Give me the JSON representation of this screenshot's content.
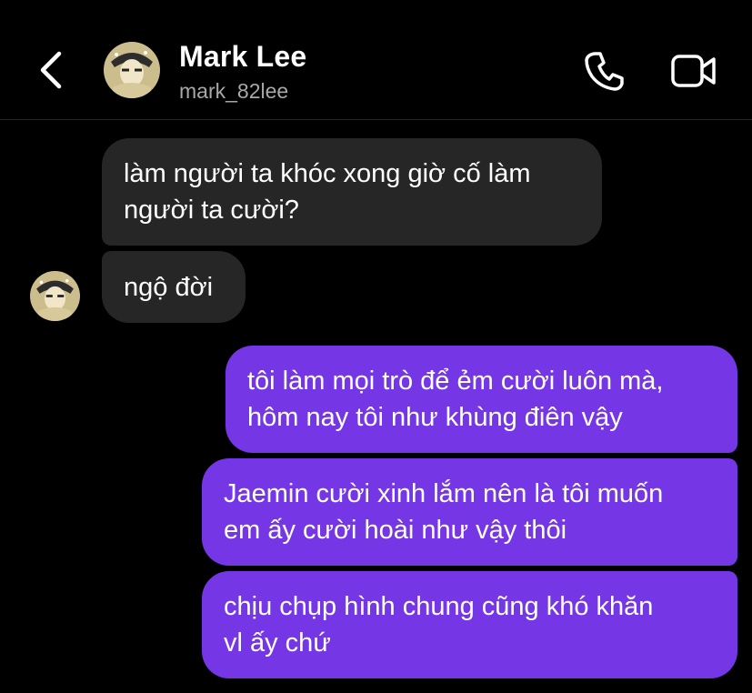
{
  "header": {
    "name": "Mark Lee",
    "username": "mark_82lee"
  },
  "icons": {
    "back": "chevron-left-icon",
    "call": "phone-icon",
    "video": "video-camera-icon"
  },
  "colors": {
    "background": "#000000",
    "incoming_bubble": "#262626",
    "outgoing_bubble": "#7537e6",
    "secondary_text": "#a8a8a8"
  },
  "messages": [
    {
      "direction": "incoming",
      "text": "làm người ta khóc xong giờ cố làm\nngười ta cười?"
    },
    {
      "direction": "incoming",
      "text": "ngộ đời"
    },
    {
      "direction": "outgoing",
      "text": "tôi làm mọi trò để ẻm cười luôn mà,\nhôm nay tôi như khùng điên vậy"
    },
    {
      "direction": "outgoing",
      "text": "Jaemin cười xinh lắm nên là tôi muốn\nem ấy cười hoài như vậy thôi"
    },
    {
      "direction": "outgoing",
      "text": "chịu chụp hình chung cũng khó khăn\nvl ấy chứ"
    }
  ]
}
